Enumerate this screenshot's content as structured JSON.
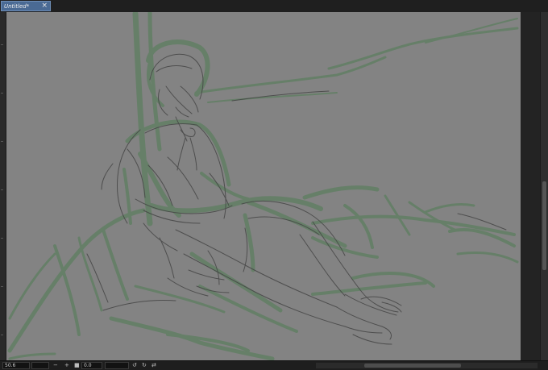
{
  "tab": {
    "title": "Untitled*",
    "close_glyph": "×"
  },
  "canvas": {
    "background": "#838383",
    "sketch_color": "#5f7f64",
    "line_color": "#4a4a4a"
  },
  "statusbar": {
    "zoom": "50.6",
    "minus": "−",
    "plus": "+",
    "angle": "0.0",
    "rotate_left": "↺",
    "rotate_right": "↻",
    "flip": "⇄"
  }
}
